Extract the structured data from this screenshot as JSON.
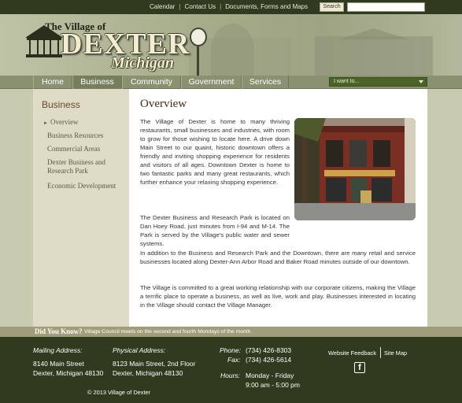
{
  "top": {
    "links": [
      "Calendar",
      "Contact Us",
      "Documents, Forms and Maps"
    ],
    "search_label": "Search",
    "search_value": ""
  },
  "logo": {
    "line1": "The Village of",
    "line2": "DEXTER",
    "line3": "Michigan"
  },
  "nav": {
    "items": [
      "Home",
      "Business",
      "Community",
      "Government",
      "Services"
    ],
    "active": "Business",
    "iwant": "I want to..."
  },
  "sidebar": {
    "title": "Business",
    "items": [
      "Overview",
      "Business Resources",
      "Commercial Areas",
      "Dexter Business and Research Park",
      "Economic Development"
    ],
    "current": "Overview"
  },
  "main": {
    "title": "Overview",
    "p1": "The Village of Dexter is home to many thriving restaurants, small businesses and industries, with room to grow for those wishing to locate here. A drive down Main Street to our quaint, historic downtown offers a friendly and inviting shopping experience for residents and visitors of all ages. Downtown Dexter is home to two fantastic parks and many great restaurants, which further enhance your relaxing shopping experience.",
    "p2": "The Dexter Business and Research Park is located on Dan Hoey Road, just minutes from I-94 and M-14. The Park is served by the Village's public water and sewer systems.",
    "p3": "In addition to the Business and Research Park and the Downtown, there are many retail and service businesses located along Dexter-Ann Arbor Road and Baker Road minutes outside of our downtown.",
    "p4": "The Village is committed to a great working relationship with our corporate citizens, making the Village a terrific place to operate a business, as well as live, work and play. Businesses interested in locating in the Village should contact the Village Manager."
  },
  "did_you_know": {
    "label": "Did You Know?",
    "text": "Village Council meets on the second and fourth Mondays of the month."
  },
  "footer": {
    "mailing_head": "Mailing Address:",
    "mailing_line1": "8140 Main Street",
    "mailing_line2": "Dexter, Michigan 48130",
    "physical_head": "Physical Address:",
    "physical_line1": "8123 Main Street, 2nd Floor",
    "physical_line2": "Dexter, Michigan 48130",
    "phone_label": "Phone:",
    "phone": "(734) 426-8303",
    "fax_label": "Fax:",
    "fax": "(734) 426-5614",
    "hours_label": "Hours:",
    "hours_line1": "Monday - Friday",
    "hours_line2": "9:00 am - 5:00 pm",
    "feedback_link": "Website Feedback",
    "sitemap_link": "Site Map",
    "social_icon": "facebook-icon",
    "copyright": "© 2013 Village of Dexter"
  },
  "colors": {
    "footer_bg": "#2f3a1f",
    "nav_bg": "#8a9170",
    "title_brown": "#4a2c12",
    "iwant_green": "#4b6326"
  }
}
